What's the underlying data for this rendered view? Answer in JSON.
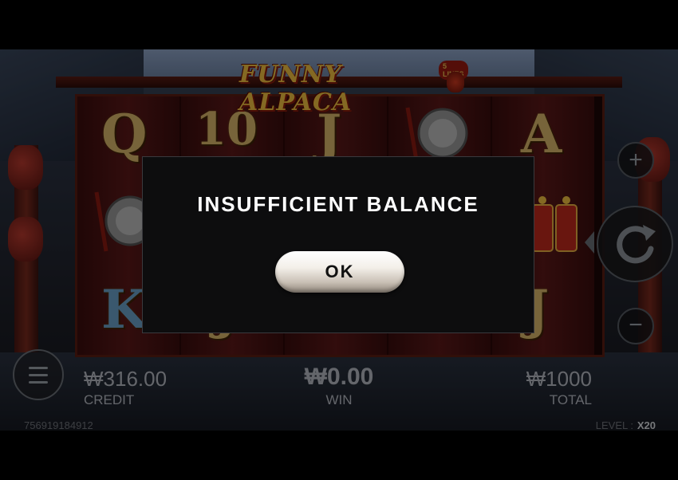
{
  "game": {
    "title": "FUNNY ALPACA",
    "lines_badge": "5 LINES",
    "reel_symbols": [
      [
        "Q",
        "gong",
        "K"
      ],
      [
        "10",
        "",
        "J"
      ],
      [
        "J",
        "",
        ""
      ],
      [
        "gong",
        "",
        ""
      ],
      [
        "A",
        "firecracker",
        "J"
      ]
    ]
  },
  "dialog": {
    "message": "INSUFFICIENT BALANCE",
    "ok_label": "OK"
  },
  "hud": {
    "credit_value": "₩316.00",
    "credit_label": "CREDIT",
    "win_value": "₩0.00",
    "win_label": "WIN",
    "total_value": "₩1000",
    "total_label": "TOTAL",
    "session_id": "756919184912",
    "level_label": "LEVEL :",
    "level_value": "X20"
  },
  "controls": {
    "plus_icon": "plus-icon",
    "minus_icon": "minus-icon",
    "spin_icon": "refresh-icon",
    "menu_icon": "hamburger-icon"
  },
  "colors": {
    "symbol_gold": "#d9b76a",
    "title_gold": "#f0c040",
    "dialog_bg": "#0d0d0e"
  }
}
